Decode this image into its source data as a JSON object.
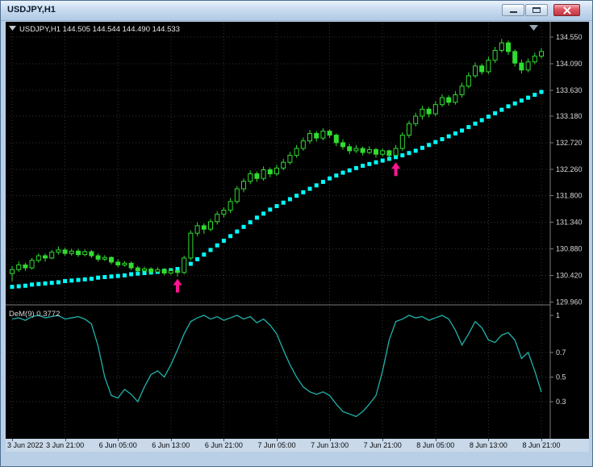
{
  "window": {
    "title": "USDJPY,H1",
    "controls": {
      "minimize": "minimize",
      "maximize": "maximize",
      "close": "close"
    }
  },
  "colors": {
    "background": "#000000",
    "grid": "#333333",
    "candle": "#30dc30",
    "bull_body": "#000000",
    "trend_dots": "#00ffff",
    "dem_line": "#20b2aa",
    "signal_arrow": "#ff1493",
    "scale_text": "#d9d9d9",
    "divider": "#7a7a7a",
    "header_text": "#e6e6e6",
    "time_axis_bg": "#c9d9ea"
  },
  "chart_data": [
    {
      "type": "candlestick",
      "symbol": "USDJPY",
      "timeframe": "H1",
      "header_text": "USDJPY,H1 144.505 144.544 144.490 144.533",
      "y_axis": {
        "labels": [
          "134.550",
          "134.090",
          "133.630",
          "133.180",
          "132.720",
          "132.260",
          "131.800",
          "131.340",
          "130.880",
          "130.420",
          "129.960"
        ],
        "ticks": [
          134.55,
          134.09,
          133.63,
          133.18,
          132.72,
          132.26,
          131.8,
          131.34,
          130.88,
          130.42,
          129.96
        ]
      },
      "x_axis": {
        "labels": [
          "3 Jun 2022",
          "3 Jun 21:00",
          "6 Jun 05:00",
          "6 Jun 13:00",
          "6 Jun 21:00",
          "7 Jun 05:00",
          "7 Jun 13:00",
          "7 Jun 21:00",
          "8 Jun 05:00",
          "8 Jun 13:00",
          "8 Jun 21:00"
        ],
        "bars_per_label": 8
      },
      "candles": [
        [
          130.45,
          130.58,
          130.32,
          130.52
        ],
        [
          130.52,
          130.66,
          130.48,
          130.6
        ],
        [
          130.6,
          130.64,
          130.5,
          130.55
        ],
        [
          130.55,
          130.72,
          130.52,
          130.68
        ],
        [
          130.68,
          130.8,
          130.64,
          130.76
        ],
        [
          130.76,
          130.8,
          130.66,
          130.72
        ],
        [
          130.72,
          130.86,
          130.7,
          130.82
        ],
        [
          130.82,
          130.92,
          130.78,
          130.86
        ],
        [
          130.86,
          130.9,
          130.76,
          130.8
        ],
        [
          130.8,
          130.88,
          130.76,
          130.84
        ],
        [
          130.84,
          130.88,
          130.74,
          130.78
        ],
        [
          130.78,
          130.87,
          130.75,
          130.83
        ],
        [
          130.83,
          130.86,
          130.72,
          130.76
        ],
        [
          130.76,
          130.8,
          130.66,
          130.7
        ],
        [
          130.7,
          130.77,
          130.67,
          130.73
        ],
        [
          130.73,
          130.75,
          130.61,
          130.65
        ],
        [
          130.65,
          130.7,
          130.56,
          130.6
        ],
        [
          130.6,
          130.67,
          130.57,
          130.63
        ],
        [
          130.63,
          130.66,
          130.51,
          130.55
        ],
        [
          130.55,
          130.58,
          130.45,
          130.5
        ],
        [
          130.5,
          130.57,
          130.47,
          130.53
        ],
        [
          130.53,
          130.56,
          130.43,
          130.48
        ],
        [
          130.48,
          130.56,
          130.45,
          130.52
        ],
        [
          130.52,
          130.54,
          130.42,
          130.46
        ],
        [
          130.46,
          130.54,
          130.43,
          130.5
        ],
        [
          130.5,
          130.52,
          130.4,
          130.47
        ],
        [
          130.47,
          130.76,
          130.44,
          130.72
        ],
        [
          130.72,
          131.2,
          130.68,
          131.15
        ],
        [
          131.15,
          131.34,
          131.1,
          131.28
        ],
        [
          131.28,
          131.32,
          131.14,
          131.22
        ],
        [
          131.22,
          131.4,
          131.18,
          131.35
        ],
        [
          131.35,
          131.53,
          131.3,
          131.48
        ],
        [
          131.48,
          131.6,
          131.42,
          131.55
        ],
        [
          131.55,
          131.76,
          131.5,
          131.7
        ],
        [
          131.7,
          131.97,
          131.66,
          131.92
        ],
        [
          131.92,
          132.1,
          131.86,
          132.05
        ],
        [
          132.05,
          132.24,
          132.0,
          132.18
        ],
        [
          132.18,
          132.22,
          132.04,
          132.1
        ],
        [
          132.1,
          132.31,
          132.06,
          132.25
        ],
        [
          132.25,
          132.29,
          132.12,
          132.18
        ],
        [
          132.18,
          132.34,
          132.14,
          132.28
        ],
        [
          132.28,
          132.44,
          132.24,
          132.38
        ],
        [
          132.38,
          132.56,
          132.34,
          132.5
        ],
        [
          132.5,
          132.68,
          132.46,
          132.62
        ],
        [
          132.62,
          132.81,
          132.58,
          132.75
        ],
        [
          132.75,
          132.94,
          132.7,
          132.88
        ],
        [
          132.88,
          132.92,
          132.74,
          132.8
        ],
        [
          132.8,
          132.97,
          132.76,
          132.92
        ],
        [
          132.92,
          132.95,
          132.8,
          132.85
        ],
        [
          132.85,
          132.88,
          132.66,
          132.72
        ],
        [
          132.72,
          132.78,
          132.6,
          132.65
        ],
        [
          132.65,
          132.7,
          132.52,
          132.58
        ],
        [
          132.58,
          132.68,
          132.54,
          132.62
        ],
        [
          132.62,
          132.65,
          132.5,
          132.55
        ],
        [
          132.55,
          132.66,
          132.52,
          132.6
        ],
        [
          132.6,
          132.63,
          132.46,
          132.52
        ],
        [
          132.52,
          132.62,
          132.48,
          132.58
        ],
        [
          132.58,
          132.6,
          132.42,
          132.5
        ],
        [
          132.5,
          132.68,
          132.46,
          132.62
        ],
        [
          132.62,
          132.9,
          132.58,
          132.85
        ],
        [
          132.85,
          133.1,
          132.8,
          133.05
        ],
        [
          133.05,
          133.24,
          133.0,
          133.18
        ],
        [
          133.18,
          133.36,
          133.12,
          133.3
        ],
        [
          133.3,
          133.34,
          133.16,
          133.22
        ],
        [
          133.22,
          133.44,
          133.18,
          133.38
        ],
        [
          133.38,
          133.56,
          133.34,
          133.5
        ],
        [
          133.5,
          133.54,
          133.36,
          133.42
        ],
        [
          133.42,
          133.61,
          133.38,
          133.55
        ],
        [
          133.55,
          133.76,
          133.5,
          133.7
        ],
        [
          133.7,
          133.94,
          133.66,
          133.88
        ],
        [
          133.88,
          134.11,
          133.84,
          134.05
        ],
        [
          134.05,
          134.09,
          133.9,
          133.95
        ],
        [
          133.95,
          134.21,
          133.91,
          134.15
        ],
        [
          134.15,
          134.38,
          134.1,
          134.32
        ],
        [
          134.32,
          134.52,
          134.28,
          134.45
        ],
        [
          134.45,
          134.49,
          134.24,
          134.3
        ],
        [
          134.3,
          134.34,
          134.04,
          134.1
        ],
        [
          134.1,
          134.16,
          133.92,
          133.98
        ],
        [
          133.98,
          134.18,
          133.94,
          134.12
        ],
        [
          134.12,
          134.28,
          134.08,
          134.22
        ],
        [
          134.22,
          134.36,
          134.18,
          134.3
        ]
      ],
      "trend_dots": [
        130.22,
        130.23,
        130.24,
        130.26,
        130.27,
        130.28,
        130.29,
        130.3,
        130.32,
        130.33,
        130.34,
        130.35,
        130.36,
        130.38,
        130.39,
        130.4,
        130.41,
        130.42,
        130.44,
        130.45,
        130.46,
        130.47,
        130.48,
        130.5,
        130.51,
        130.53,
        130.56,
        130.62,
        130.7,
        130.78,
        130.86,
        130.94,
        131.02,
        131.1,
        131.18,
        131.26,
        131.34,
        131.42,
        131.49,
        131.56,
        131.62,
        131.68,
        131.74,
        131.8,
        131.86,
        131.92,
        131.98,
        132.04,
        132.1,
        132.15,
        132.2,
        132.24,
        132.28,
        132.32,
        132.35,
        132.38,
        132.41,
        132.44,
        132.47,
        132.5,
        132.54,
        132.58,
        132.63,
        132.68,
        132.73,
        132.78,
        132.83,
        132.88,
        132.93,
        132.99,
        133.05,
        133.11,
        133.17,
        133.23,
        133.29,
        133.35,
        133.4,
        133.45,
        133.5,
        133.55,
        133.6
      ],
      "signals": [
        {
          "bar": 25,
          "price": 130.36,
          "direction": "up"
        },
        {
          "bar": 58,
          "price": 132.38,
          "direction": "up"
        }
      ]
    },
    {
      "type": "line",
      "indicator": "DeMarker",
      "label_text": "DeM(9) 0.3772",
      "name": "DeM(9)",
      "current_value": "0.3772",
      "scale": [
        {
          "label": "1",
          "value": 1
        },
        {
          "label": "0.7",
          "value": 0.7
        },
        {
          "label": "0.5",
          "value": 0.5
        },
        {
          "label": "0.3",
          "value": 0.3
        }
      ],
      "level_lines": [
        0.7,
        0.5,
        0.3
      ],
      "range": [
        0,
        1
      ],
      "values": [
        0.97,
        0.98,
        0.96,
        0.99,
        1.0,
        0.98,
        0.99,
        1.0,
        0.97,
        0.98,
        0.99,
        0.97,
        0.93,
        0.75,
        0.5,
        0.35,
        0.33,
        0.4,
        0.36,
        0.3,
        0.42,
        0.52,
        0.55,
        0.5,
        0.6,
        0.72,
        0.85,
        0.95,
        0.98,
        1.0,
        0.97,
        0.99,
        0.96,
        0.98,
        1.0,
        0.97,
        0.99,
        0.94,
        0.97,
        0.92,
        0.85,
        0.72,
        0.6,
        0.5,
        0.42,
        0.38,
        0.36,
        0.38,
        0.35,
        0.28,
        0.22,
        0.2,
        0.18,
        0.22,
        0.28,
        0.35,
        0.55,
        0.8,
        0.95,
        0.97,
        1.0,
        0.98,
        0.99,
        0.96,
        0.98,
        1.0,
        0.97,
        0.88,
        0.76,
        0.85,
        0.95,
        0.9,
        0.8,
        0.78,
        0.84,
        0.86,
        0.8,
        0.65,
        0.7,
        0.55,
        0.3772
      ]
    }
  ]
}
